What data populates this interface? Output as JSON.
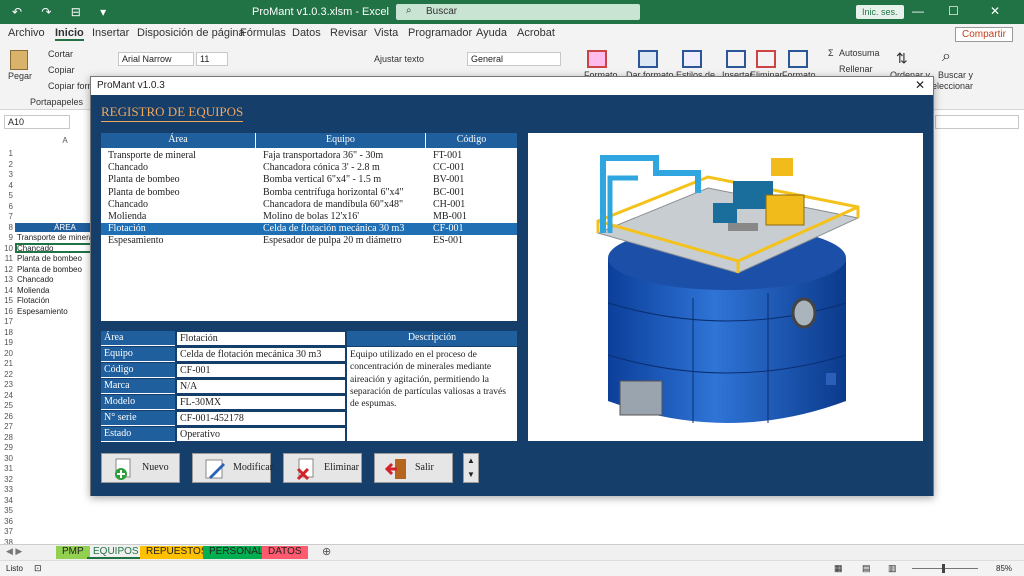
{
  "titlebar": {
    "quick_access": "↶ ↷ ⊟ ▾",
    "doc_title": "ProMant v1.0.3.xlsm  -  Excel",
    "search_placeholder": "Buscar",
    "signin_label": "Inic. ses.",
    "win_min": "—",
    "win_max": "☐",
    "win_close": "✕"
  },
  "menu": {
    "items": [
      "Archivo",
      "Inicio",
      "Insertar",
      "Disposición de página",
      "Fórmulas",
      "Datos",
      "Revisar",
      "Vista",
      "Programador",
      "Ayuda",
      "Acrobat"
    ],
    "share_label": "Compartir"
  },
  "ribbon": {
    "paste": "Pegar",
    "cut": "Cortar",
    "copy": "Copiar",
    "copy_format": "Copiar form",
    "clipboard_group": "Portapapeles",
    "font_name": "Arial Narrow",
    "font_size": "11",
    "wrap_text": "Ajustar texto",
    "number_format": "General",
    "conditional_format": "Formato",
    "table_format": "Dar formato",
    "cell_styles": "Estilos de",
    "insert": "Insertar",
    "delete": "Eliminar",
    "format": "Formato",
    "autosum": "Autosuma",
    "fill": "Rellenar",
    "sort": "Ordenar y",
    "find": "Buscar y",
    "find2": "eleccionar"
  },
  "formula": {
    "namebox": "A10"
  },
  "sheet": {
    "col_a_header": "A",
    "row_nums": [
      "1",
      "2",
      "3",
      "4",
      "5",
      "6",
      "7",
      "8",
      "9",
      "10",
      "11",
      "12",
      "13",
      "14",
      "15",
      "16",
      "17",
      "18",
      "19",
      "20",
      "21",
      "22",
      "23",
      "24",
      "25",
      "26",
      "27",
      "28",
      "29",
      "30",
      "31",
      "32",
      "33",
      "34",
      "35",
      "36",
      "37",
      "38"
    ],
    "header_cell": "ÁREA",
    "cells": [
      "Transporte de mineral",
      "Chancado",
      "Planta de bombeo",
      "Planta de bombeo",
      "Chancado",
      "Molienda",
      "Flotación",
      "Espesamiento"
    ]
  },
  "tabs": [
    {
      "label": "PMP",
      "color": "#92d050"
    },
    {
      "label": "EQUIPOS",
      "color": "#ffffff"
    },
    {
      "label": "REPUESTOS",
      "color": "#ffc000"
    },
    {
      "label": "PERSONAL",
      "color": "#00b050"
    },
    {
      "label": "DATOS",
      "color": "#ff5a6e"
    }
  ],
  "status": {
    "ready": "Listo",
    "zoom": "85%"
  },
  "dialog": {
    "title": "ProMant v1.0.3",
    "heading": "REGISTRO DE EQUIPOS",
    "list_headers": {
      "area": "Área",
      "equipo": "Equipo",
      "codigo": "Código"
    },
    "rows": [
      {
        "area": "Transporte de mineral",
        "equipo": "Faja transportadora 36\" - 30m",
        "codigo": "FT-001"
      },
      {
        "area": "Chancado",
        "equipo": "Chancadora cónica 3' - 2.8 m",
        "codigo": "CC-001"
      },
      {
        "area": "Planta de bombeo",
        "equipo": "Bomba vertical 6\"x4\" - 1.5 m",
        "codigo": "BV-001"
      },
      {
        "area": "Planta de bombeo",
        "equipo": "Bomba centrífuga horizontal 6\"x4\"",
        "codigo": "BC-001"
      },
      {
        "area": "Chancado",
        "equipo": "Chancadora de mandíbula 60\"x48\"",
        "codigo": "CH-001"
      },
      {
        "area": "Molienda",
        "equipo": "Molino de bolas 12'x16'",
        "codigo": "MB-001"
      },
      {
        "area": "Flotación",
        "equipo": "Celda de flotación mecánica 30 m3",
        "codigo": "CF-001"
      },
      {
        "area": "Espesamiento",
        "equipo": "Espesador de pulpa 20 m diámetro",
        "codigo": "ES-001"
      }
    ],
    "fields": [
      {
        "label": "Área",
        "value": "Flotación"
      },
      {
        "label": "Equipo",
        "value": "Celda de flotación mecánica 30 m3"
      },
      {
        "label": "Código",
        "value": "CF-001"
      },
      {
        "label": "Marca",
        "value": "N/A"
      },
      {
        "label": "Modelo",
        "value": "FL-30MX"
      },
      {
        "label": "N° serie",
        "value": "CF-001-452178"
      },
      {
        "label": "Estado",
        "value": "Operativo"
      }
    ],
    "description_header": "Descripción",
    "description": "Equipo utilizado en el proceso de concentración de minerales mediante aireación y agitación, permitiendo la separación de partículas valiosas a través de espumas.",
    "buttons": {
      "nuevo": "Nuevo",
      "modificar": "Modificar",
      "eliminar": "Eliminar",
      "salir": "Salir"
    }
  }
}
